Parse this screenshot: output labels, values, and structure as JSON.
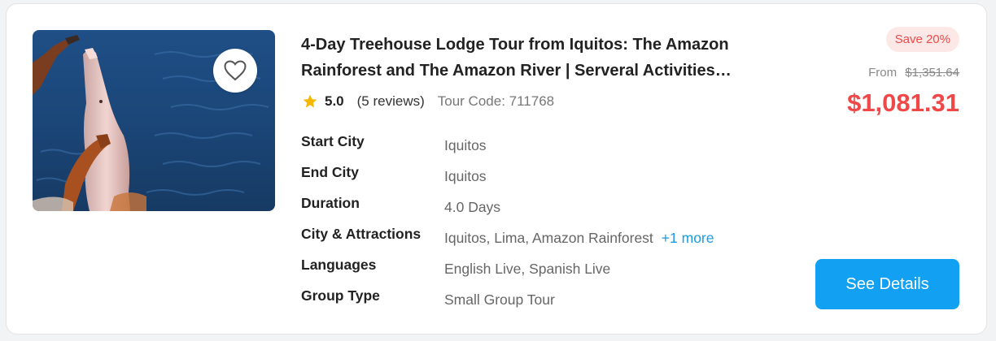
{
  "tour": {
    "title": "4-Day Treehouse Lodge Tour from Iquitos: The Amazon Rainforest and The Amazon River | Serveral Activities Included",
    "rating": "5.0",
    "reviews": "(5 reviews)",
    "tour_code": "Tour Code: 711768",
    "image": "pink river dolphin in water",
    "favorite_icon": "heart-outline-icon",
    "star_icon": "star-icon",
    "star_color": "#f5b800"
  },
  "details": {
    "start_city": {
      "label": "Start City",
      "value": "Iquitos"
    },
    "end_city": {
      "label": "End City",
      "value": "Iquitos"
    },
    "duration": {
      "label": "Duration",
      "value": "4.0 Days"
    },
    "attractions": {
      "label": "City & Attractions",
      "value": "Iquitos, Lima, Amazon Rainforest",
      "more": "+1 more"
    },
    "languages": {
      "label": "Languages",
      "value": "English Live, Spanish Live"
    },
    "group_type": {
      "label": "Group Type",
      "value": "Small Group Tour"
    }
  },
  "pricing": {
    "save_badge": "Save 20%",
    "from_label": "From",
    "original_price": "$1,351.64",
    "price": "$1,081.31",
    "accent_color": "#f04848"
  },
  "actions": {
    "see_details": "See Details",
    "button_color": "#11a0f2",
    "link_color": "#1a9be6"
  }
}
